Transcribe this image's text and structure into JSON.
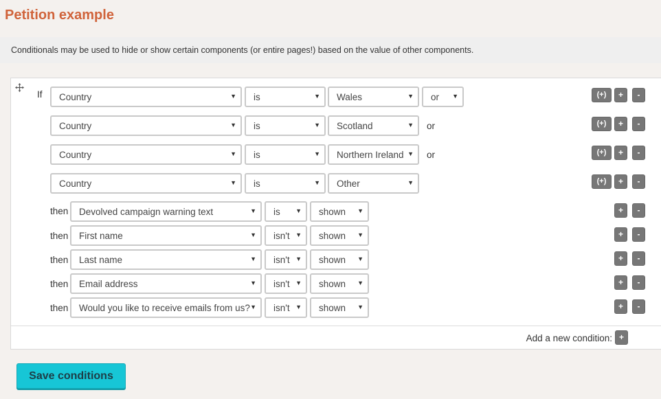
{
  "page_title": "Petition example",
  "info_text": "Conditionals may be used to hide or show certain components (or entire pages!) based on the value of other components.",
  "if_label": "If",
  "then_label": "then",
  "or_label": "or",
  "group_label": "(+)",
  "plus_label": "+",
  "minus_label": "-",
  "conditions": [
    {
      "field": "Country",
      "operator": "is",
      "value": "Wales",
      "join": "or"
    },
    {
      "field": "Country",
      "operator": "is",
      "value": "Scotland",
      "join": "or"
    },
    {
      "field": "Country",
      "operator": "is",
      "value": "Northern Ireland",
      "join": "or"
    },
    {
      "field": "Country",
      "operator": "is",
      "value": "Other",
      "join": ""
    }
  ],
  "actions": [
    {
      "target": "Devolved campaign warning text",
      "operator": "is",
      "state": "shown"
    },
    {
      "target": "First name",
      "operator": "isn't",
      "state": "shown"
    },
    {
      "target": "Last name",
      "operator": "isn't",
      "state": "shown"
    },
    {
      "target": "Email address",
      "operator": "isn't",
      "state": "shown"
    },
    {
      "target": "Would you like to receive emails from us?",
      "operator": "isn't",
      "state": "shown"
    }
  ],
  "add_condition_label": "Add a new condition:",
  "save_label": "Save conditions"
}
